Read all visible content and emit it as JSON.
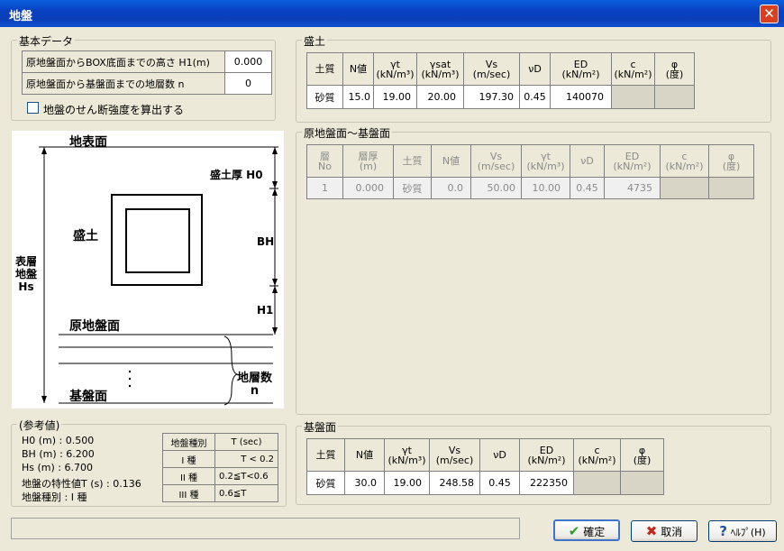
{
  "window": {
    "title": "地盤",
    "close_glyph": "✕"
  },
  "kihon": {
    "legend": "基本データ",
    "rows": [
      {
        "label": "原地盤面からBOX底面までの高さ H1(m)",
        "value": "0.000"
      },
      {
        "label": "原地盤面から基盤面までの地層数  n",
        "value": "0"
      }
    ],
    "checkbox_label": "地盤のせん断強度を算出する"
  },
  "morido": {
    "legend": "盛土",
    "headers": [
      "土質",
      "N値",
      "γt\n(kN/m³)",
      "γsat\n(kN/m³)",
      "Vs\n(m/sec)",
      "νD",
      "ED\n(kN/m²)",
      "c\n(kN/m²)",
      "φ\n(度)"
    ],
    "row": [
      "砂質",
      "15.0",
      "19.00",
      "20.00",
      "197.30",
      "0.45",
      "140070",
      "",
      ""
    ]
  },
  "genjiban": {
    "legend": "原地盤面～基盤面",
    "headers": [
      "層\nNo",
      "層厚\n(m)",
      "土質",
      "N値",
      "Vs\n(m/sec)",
      "γt\n(kN/m³)",
      "νD",
      "ED\n(kN/m²)",
      "c\n(kN/m²)",
      "φ\n(度)"
    ],
    "row": [
      "1",
      "0.000",
      "砂質",
      "0.0",
      "50.00",
      "10.00",
      "0.45",
      "4735",
      "",
      ""
    ]
  },
  "kiban": {
    "legend": "基盤面",
    "headers": [
      "土質",
      "N値",
      "γt\n(kN/m³)",
      "Vs\n(m/sec)",
      "νD",
      "ED\n(kN/m²)",
      "c\n(kN/m²)",
      "φ\n(度)"
    ],
    "row": [
      "砂質",
      "30.0",
      "19.00",
      "248.58",
      "0.45",
      "222350",
      "",
      ""
    ]
  },
  "diagram": {
    "surface": "地表面",
    "fill_thickness": "盛土厚 H0",
    "fill": "盛土",
    "bh": "BH",
    "h1": "H1",
    "surface_layer": "表層\n地盤\nHs",
    "original_ground": "原地盤面",
    "layer_count": "地層数\nn",
    "base": "基盤面"
  },
  "reference": {
    "legend": "(参考値)",
    "lines": [
      "H0 (m) : 0.500",
      "BH (m) : 6.200",
      "Hs (m) : 6.700",
      "地盤の特性値T (s) : 0.136",
      "地盤種別           : I 種"
    ],
    "table_headers": [
      "地盤種別",
      "T (sec)"
    ],
    "table_rows": [
      [
        "I 種",
        "T < 0.2"
      ],
      [
        "II 種",
        "0.2≦T<0.6"
      ],
      [
        "III 種",
        "0.6≦T"
      ]
    ]
  },
  "buttons": {
    "ok": "確定",
    "cancel": "取消",
    "help": "ﾍﾙﾌﾟ(H)"
  },
  "colors": {
    "title_bar": "#0a5fdf",
    "window_bg": "#ece9d8",
    "ok_icon": "#2a9d2a",
    "cancel_icon": "#c0281e",
    "help_icon": "#1f4fb0"
  }
}
